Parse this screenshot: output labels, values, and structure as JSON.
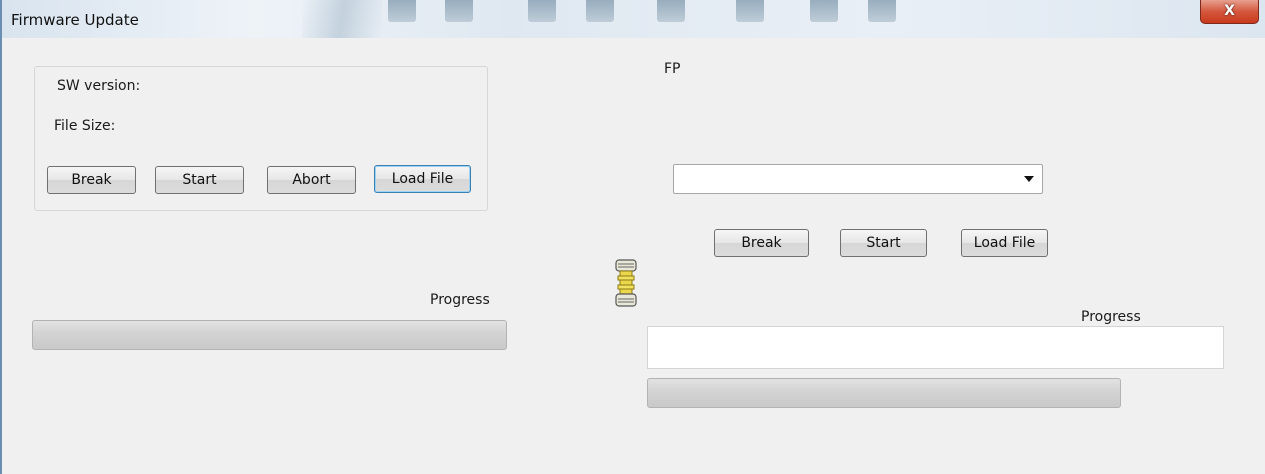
{
  "window": {
    "title": "Firmware Update",
    "close_label": "X"
  },
  "left_panel": {
    "sw_version_label": "SW version:",
    "file_size_label": "File Size:",
    "buttons": {
      "break": "Break",
      "start": "Start",
      "abort": "Abort",
      "load_file": "Load File"
    },
    "progress_label": "Progress",
    "progress_value": 0
  },
  "right_panel": {
    "fp_label": "FP",
    "combo_value": "",
    "buttons": {
      "break": "Break",
      "start": "Start",
      "load_file": "Load File"
    },
    "progress_label": "Progress",
    "text_value": "",
    "progress_value": 0
  },
  "icons": {
    "connector": "connector-icon",
    "dropdown": "chevron-down-icon"
  }
}
